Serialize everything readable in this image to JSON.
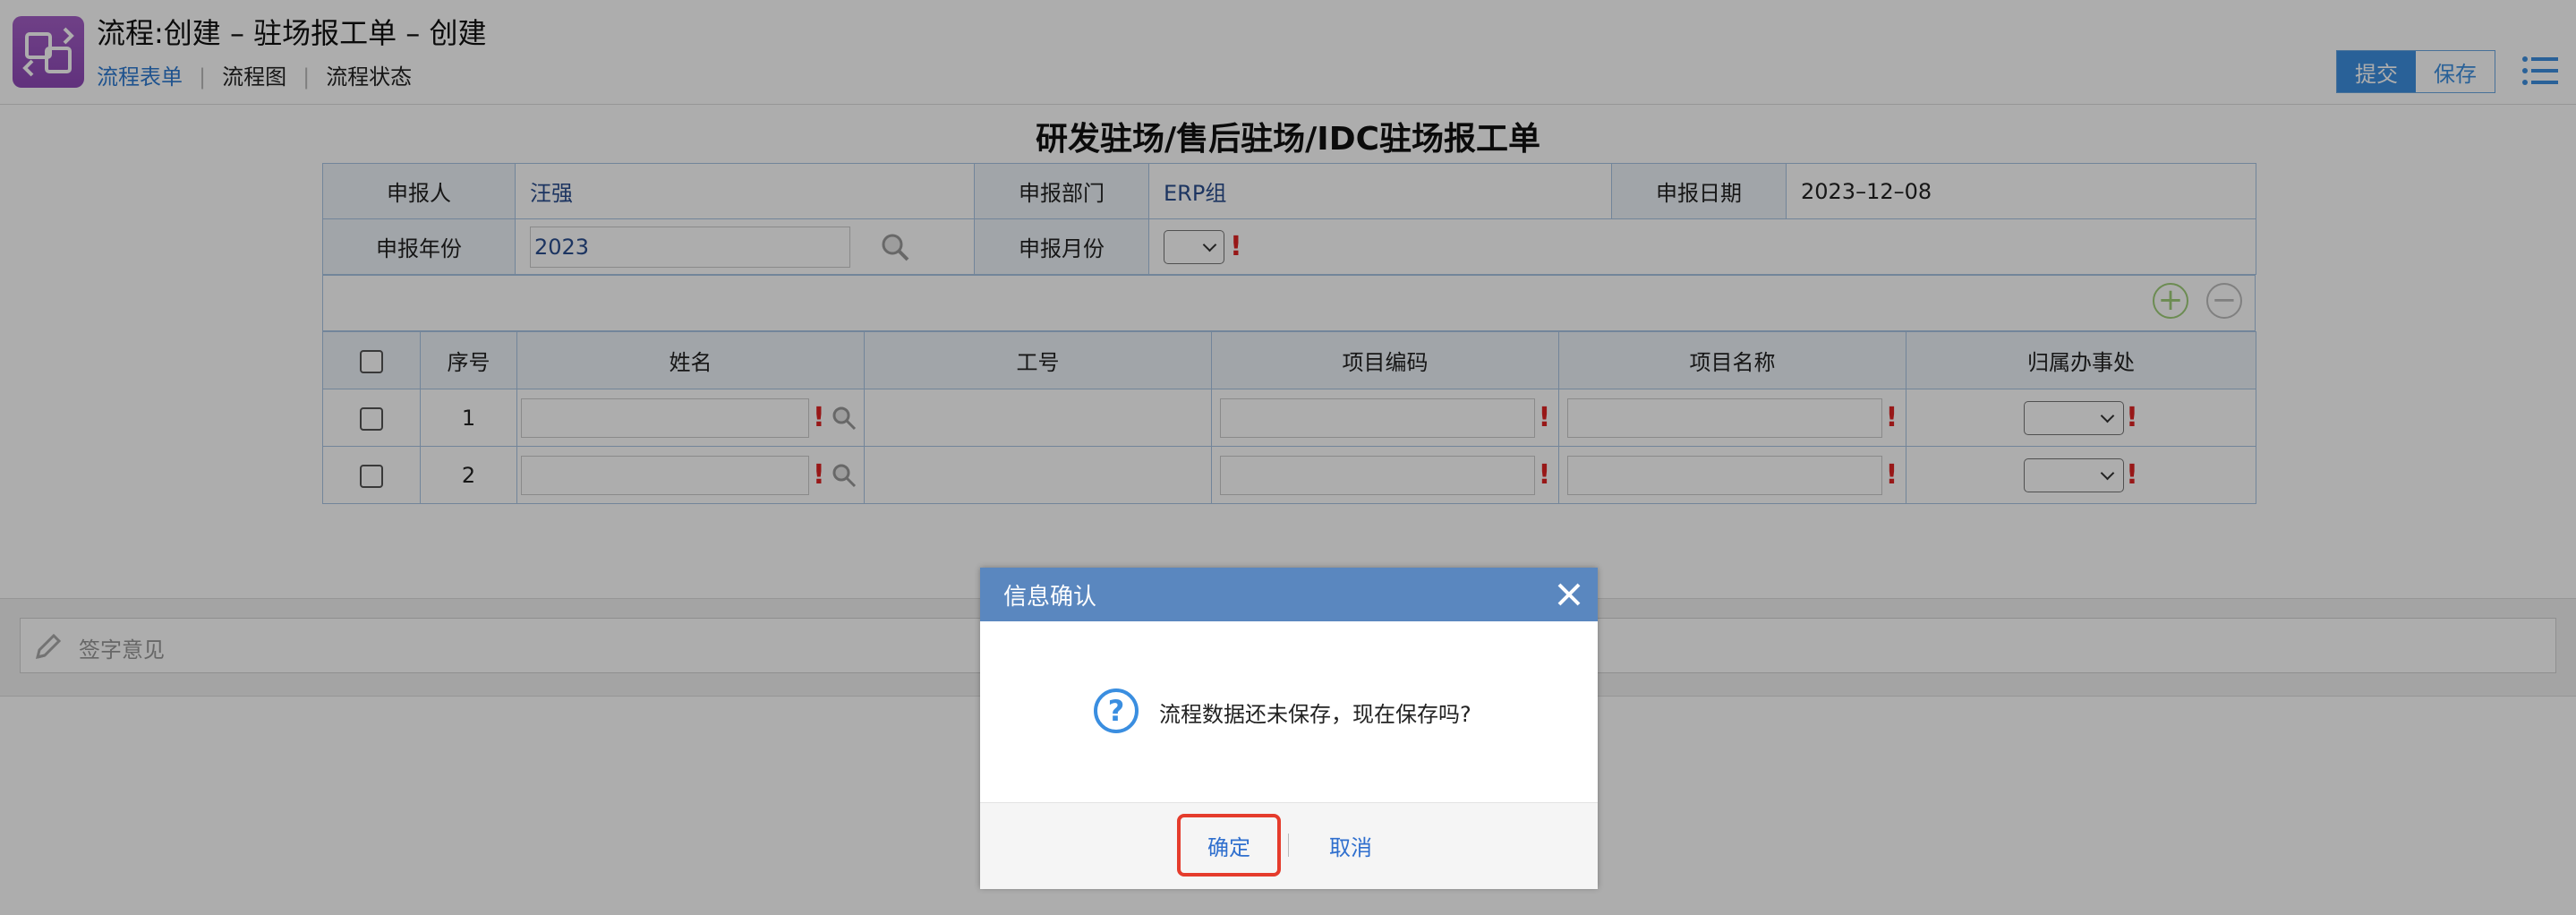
{
  "header": {
    "title": "流程:创建 – 驻场报工单 – 创建",
    "nav": [
      "流程表单",
      "流程图",
      "流程状态"
    ],
    "submit_label": "提交",
    "save_label": "保存"
  },
  "form": {
    "title": "研发驻场/售后驻场/IDC驻场报工单",
    "reporter_label": "申报人",
    "reporter_value": "汪强",
    "dept_label": "申报部门",
    "dept_value": "ERP组",
    "date_label": "申报日期",
    "date_value": "2023–12–08",
    "year_label": "申报年份",
    "year_value": "2023",
    "month_label": "申报月份"
  },
  "grid": {
    "columns": [
      "序号",
      "姓名",
      "工号",
      "项目编码",
      "项目名称",
      "归属办事处"
    ],
    "rows": [
      {
        "no": "1"
      },
      {
        "no": "2"
      }
    ]
  },
  "signature": {
    "placeholder": "签字意见"
  },
  "dialog": {
    "title": "信息确认",
    "message": "流程数据还未保存，现在保存吗?",
    "ok_label": "确定",
    "cancel_label": "取消"
  },
  "colors": {
    "accent": "#3d8fe0",
    "dialog_header": "#5a87bf",
    "required": "#e02424",
    "highlight": "#e53c2c"
  }
}
